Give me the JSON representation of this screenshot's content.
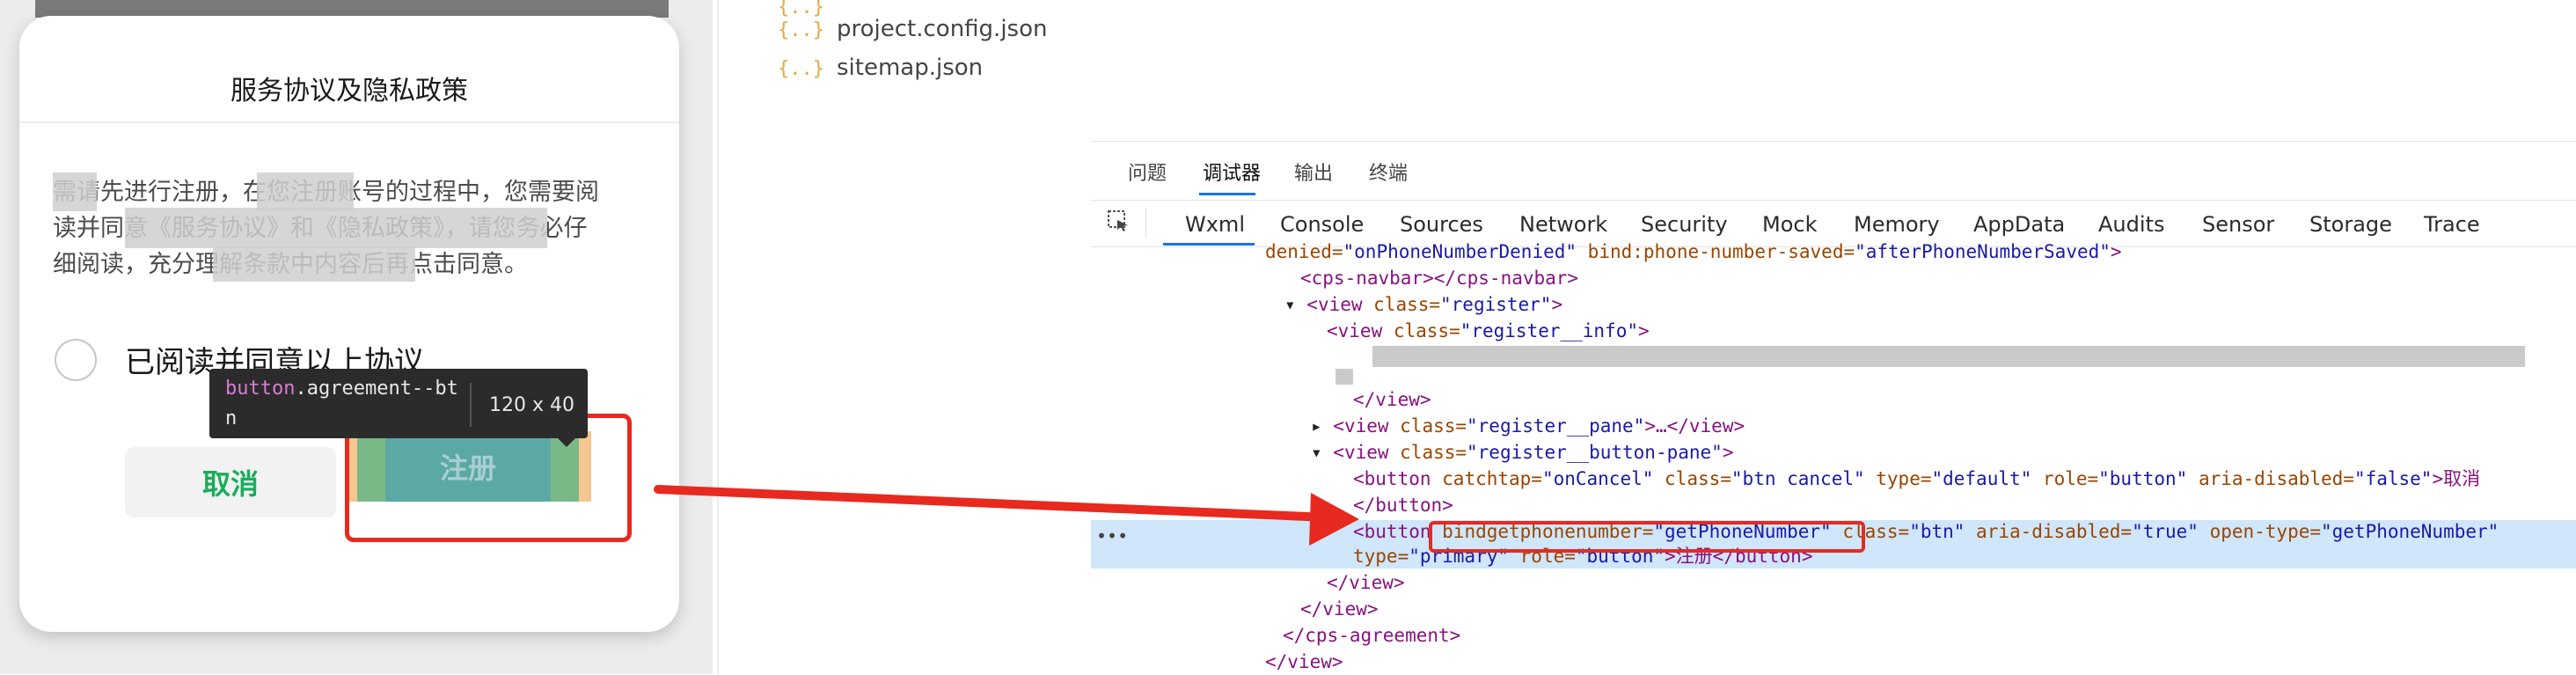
{
  "modal": {
    "title": "服务协议及隐私政策",
    "body_lines": [
      "需请先进行注册，在您注册账号的过程中，您需要阅",
      "读并同意《服务协议》和《隐私政策》，请您务必仔",
      "细阅读，充分理解条款中内容后再点击同意。"
    ],
    "agree_label": "已阅读并同意以上协议",
    "cancel_label": "取消",
    "register_label": "注册"
  },
  "tooltip": {
    "tag": "button",
    "cls": ".agreement--bt",
    "cls2": "n",
    "size": "120 x 40"
  },
  "file_tree": [
    "project.config.json",
    "sitemap.json"
  ],
  "file_icon_glyph": "{..}",
  "devtools": {
    "tabs_top": [
      "问题",
      "调试器",
      "输出",
      "终端"
    ],
    "active_top": "调试器",
    "tabs": [
      "Wxml",
      "Console",
      "Sources",
      "Network",
      "Security",
      "Mock",
      "Memory",
      "AppData",
      "Audits",
      "Sensor",
      "Storage",
      "Trace"
    ],
    "active_tab": "Wxml",
    "code": {
      "l1a": "denied=",
      "l1b": "\"onPhoneNumberDenied\"",
      "l1c": " bind:phone-number-saved=",
      "l1d": "\"afterPhoneNumberSaved\"",
      "l1e": ">",
      "l2": "<cps-navbar></cps-navbar>",
      "l3a": "<view ",
      "l3b": "class=",
      "l3c": "\"register\"",
      "l3d": ">",
      "l4a": "<view ",
      "l4b": "class=",
      "l4c": "\"register__info\"",
      "l4d": ">",
      "l5": "</view>",
      "l6a": "<view ",
      "l6b": "class=",
      "l6c": "\"register__pane\"",
      "l6d": ">…</view>",
      "l7a": "<view ",
      "l7b": "class=",
      "l7c": "\"register__button-pane\"",
      "l7d": ">",
      "l8a": "<button ",
      "l8b": "catchtap=",
      "l8c": "\"onCancel\"",
      "l8d": " class=",
      "l8e": "\"btn cancel\"",
      "l8f": " type=",
      "l8g": "\"default\"",
      "l8h": " role=",
      "l8i": "\"button\"",
      "l8j": " aria-disabled=",
      "l8k": "\"false\"",
      "l8l": ">取消",
      "l9": "</button>",
      "l10a": "<button ",
      "l10b": "bindgetphonenumber=",
      "l10c": "\"getPhoneNumber\"",
      "l10d": " class=",
      "l10e": "\"btn\"",
      "l10f": " aria-disabled=",
      "l10g": "\"true\"",
      "l10h": " open-type=",
      "l10i": "\"getPhoneNumber\"",
      "l11a": "type=",
      "l11b": "\"primary\"",
      "l11c": " role=",
      "l11d": "\"button\"",
      "l11e": ">注册</button>",
      "l12": "</view>",
      "l13": "</view>",
      "l14": "</cps-agreement>",
      "l15": "</view>"
    }
  },
  "colors": {
    "accent_red": "#e8291f",
    "green": "#1aad5b",
    "link_blue": "#1a73e8"
  }
}
